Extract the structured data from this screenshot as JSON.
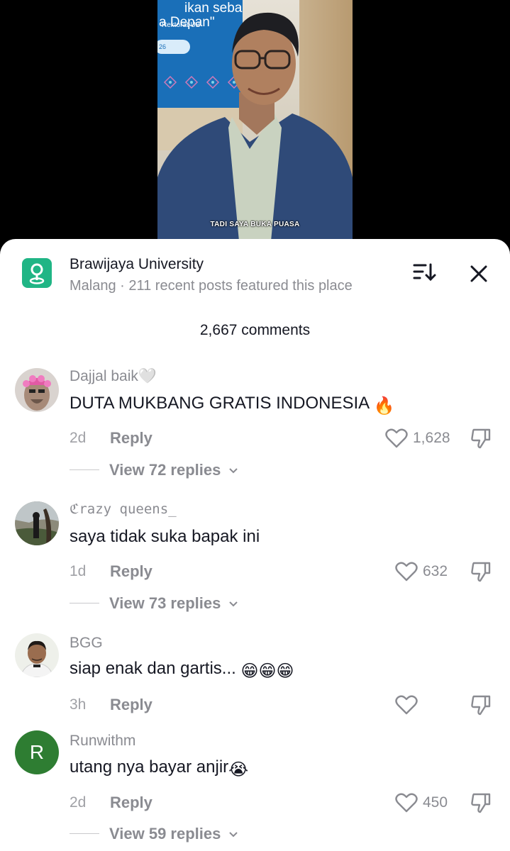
{
  "video": {
    "banner_line1": "ikan seba",
    "banner_line1b": "a Depan\"",
    "banner_line2": "Rektorat UB",
    "banner_pill": "26",
    "caption": "TADI SAYA BUKA PUASA"
  },
  "place": {
    "title": "Brawijaya University",
    "subtitle": "Malang · 211 recent posts featured this place"
  },
  "comments_count": "2,667 comments",
  "comments": [
    {
      "username": "Dajjal baik🤍",
      "text": "DUTA MUKBANG GRATIS INDONESIA",
      "emoji": "🔥",
      "time": "2d",
      "reply_label": "Reply",
      "likes": "1,628",
      "view_replies": "View 72 replies"
    },
    {
      "username": "ℭrazy queens_",
      "text": "saya tidak suka bapak ini",
      "emoji": "",
      "time": "1d",
      "reply_label": "Reply",
      "likes": "632",
      "view_replies": "View 73 replies"
    },
    {
      "username": "BGG",
      "text": "siap enak dan gartis...",
      "emoji": "😁😁😁",
      "time": "3h",
      "reply_label": "Reply",
      "likes": "",
      "view_replies": ""
    },
    {
      "username": "Runwithm",
      "text": "utang nya bayar anjir",
      "emoji": "😭",
      "avatar_letter": "R",
      "time": "2d",
      "reply_label": "Reply",
      "likes": "450",
      "view_replies": "View 59 replies"
    }
  ],
  "icons": {
    "place": "location-pin-icon",
    "sort": "sort-icon",
    "close": "close-icon",
    "like": "heart-icon",
    "dislike": "thumbs-down-icon",
    "expand": "chevron-down-icon"
  },
  "colors": {
    "place_icon_bg": "#20b585",
    "avatar_r_bg": "#2e7d32",
    "text_primary": "#161823",
    "text_secondary": "#8a8b91"
  }
}
